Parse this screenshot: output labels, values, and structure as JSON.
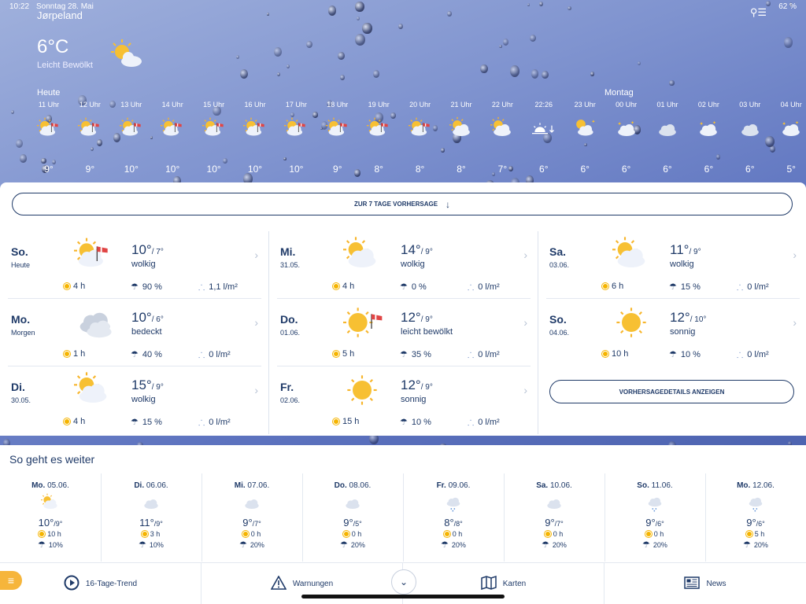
{
  "status": {
    "time": "10:22",
    "date": "Sonntag 28. Mai",
    "battery": "62 %"
  },
  "location": "Jørpeland",
  "current": {
    "temp": "6°C",
    "condition": "Leicht Bewölkt",
    "icon": "partly-cloudy-icon"
  },
  "day_labels": {
    "today": "Heute",
    "monday": "Montag"
  },
  "hourly": [
    {
      "time": "11 Uhr",
      "temp": "9°",
      "icon": "partly-cloudy-wind-icon"
    },
    {
      "time": "12 Uhr",
      "temp": "9°",
      "icon": "partly-cloudy-wind-icon"
    },
    {
      "time": "13 Uhr",
      "temp": "10°",
      "icon": "partly-cloudy-wind-icon"
    },
    {
      "time": "14 Uhr",
      "temp": "10°",
      "icon": "partly-cloudy-wind-icon"
    },
    {
      "time": "15 Uhr",
      "temp": "10°",
      "icon": "partly-cloudy-wind-icon"
    },
    {
      "time": "16 Uhr",
      "temp": "10°",
      "icon": "partly-cloudy-wind-icon"
    },
    {
      "time": "17 Uhr",
      "temp": "10°",
      "icon": "partly-cloudy-wind-icon"
    },
    {
      "time": "18 Uhr",
      "temp": "9°",
      "icon": "partly-cloudy-wind-icon"
    },
    {
      "time": "19 Uhr",
      "temp": "8°",
      "icon": "partly-cloudy-wind-icon"
    },
    {
      "time": "20 Uhr",
      "temp": "8°",
      "icon": "partly-cloudy-wind-icon"
    },
    {
      "time": "21 Uhr",
      "temp": "8°",
      "icon": "partly-cloudy-icon"
    },
    {
      "time": "22 Uhr",
      "temp": "7°",
      "icon": "partly-cloudy-icon"
    },
    {
      "time": "22:26",
      "temp": "6°",
      "icon": "sunset-icon"
    },
    {
      "time": "23 Uhr",
      "temp": "6°",
      "icon": "moon-cloud-icon"
    },
    {
      "time": "00 Uhr",
      "temp": "6°",
      "icon": "night-cloud-icon"
    },
    {
      "time": "01 Uhr",
      "temp": "6°",
      "icon": "cloud-icon"
    },
    {
      "time": "02 Uhr",
      "temp": "6°",
      "icon": "night-cloud-icon"
    },
    {
      "time": "03 Uhr",
      "temp": "6°",
      "icon": "cloud-icon"
    },
    {
      "time": "04 Uhr",
      "temp": "5°",
      "icon": "night-cloud-icon"
    }
  ],
  "buttons": {
    "seven_day": "ZUR 7 TAGE VORHERSAGE",
    "details": "VORHERSAGEDETAILS ANZEIGEN"
  },
  "days": [
    {
      "name": "So.",
      "sub": "Heute",
      "hi": "10°",
      "lo": "/ 7°",
      "cond": "wolkig",
      "sun": "4 h",
      "rain_prob": "90 %",
      "rain": "1,1 l/m²",
      "icon": "partly-cloudy-wind-icon"
    },
    {
      "name": "Mo.",
      "sub": "Morgen",
      "hi": "10°",
      "lo": "/ 6°",
      "cond": "bedeckt",
      "sun": "1 h",
      "rain_prob": "40 %",
      "rain": "0 l/m²",
      "icon": "overcast-icon"
    },
    {
      "name": "Di.",
      "sub": "30.05.",
      "hi": "15°",
      "lo": "/ 9°",
      "cond": "wolkig",
      "sun": "4 h",
      "rain_prob": "15 %",
      "rain": "0 l/m²",
      "icon": "partly-cloudy-icon"
    },
    {
      "name": "Mi.",
      "sub": "31.05.",
      "hi": "14°",
      "lo": "/ 9°",
      "cond": "wolkig",
      "sun": "4 h",
      "rain_prob": "0 %",
      "rain": "0 l/m²",
      "icon": "partly-cloudy-icon"
    },
    {
      "name": "Do.",
      "sub": "01.06.",
      "hi": "12°",
      "lo": "/ 9°",
      "cond": "leicht bewölkt",
      "sun": "5 h",
      "rain_prob": "35 %",
      "rain": "0 l/m²",
      "icon": "sun-wind-icon"
    },
    {
      "name": "Fr.",
      "sub": "02.06.",
      "hi": "12°",
      "lo": "/ 9°",
      "cond": "sonnig",
      "sun": "15 h",
      "rain_prob": "10 %",
      "rain": "0 l/m²",
      "icon": "sun-icon"
    },
    {
      "name": "Sa.",
      "sub": "03.06.",
      "hi": "11°",
      "lo": "/ 9°",
      "cond": "wolkig",
      "sun": "6 h",
      "rain_prob": "15 %",
      "rain": "0 l/m²",
      "icon": "partly-cloudy-icon"
    },
    {
      "name": "So.",
      "sub": "04.06.",
      "hi": "12°",
      "lo": "/ 10°",
      "cond": "sonnig",
      "sun": "10 h",
      "rain_prob": "10 %",
      "rain": "0 l/m²",
      "icon": "sun-icon"
    }
  ],
  "outlook": {
    "heading": "So geht es weiter",
    "items": [
      {
        "dow": "Mo.",
        "date": "05.06.",
        "hi": "10°",
        "lo": "/9°",
        "sun": "10 h",
        "rain": "10%",
        "icon": "partly-cloudy-icon"
      },
      {
        "dow": "Di.",
        "date": "06.06.",
        "hi": "11°",
        "lo": "/9°",
        "sun": "3 h",
        "rain": "10%",
        "icon": "cloud-icon"
      },
      {
        "dow": "Mi.",
        "date": "07.06.",
        "hi": "9°",
        "lo": "/7°",
        "sun": "0 h",
        "rain": "20%",
        "icon": "cloud-icon"
      },
      {
        "dow": "Do.",
        "date": "08.06.",
        "hi": "9°",
        "lo": "/5°",
        "sun": "0 h",
        "rain": "20%",
        "icon": "cloud-icon"
      },
      {
        "dow": "Fr.",
        "date": "09.06.",
        "hi": "8°",
        "lo": "/8°",
        "sun": "0 h",
        "rain": "20%",
        "icon": "rain-cloud-icon"
      },
      {
        "dow": "Sa.",
        "date": "10.06.",
        "hi": "9°",
        "lo": "/7°",
        "sun": "0 h",
        "rain": "20%",
        "icon": "cloud-icon"
      },
      {
        "dow": "So.",
        "date": "11.06.",
        "hi": "9°",
        "lo": "/6°",
        "sun": "0 h",
        "rain": "20%",
        "icon": "rain-cloud-icon"
      },
      {
        "dow": "Mo.",
        "date": "12.06.",
        "hi": "9°",
        "lo": "/6°",
        "sun": "5 h",
        "rain": "20%",
        "icon": "rain-cloud-icon"
      }
    ]
  },
  "tabs": [
    {
      "label": "16-Tage-Trend",
      "icon": "play-circle-icon"
    },
    {
      "label": "Warnungen",
      "icon": "warning-icon"
    },
    {
      "label": "Karten",
      "icon": "map-icon"
    },
    {
      "label": "News",
      "icon": "newspaper-icon"
    }
  ]
}
